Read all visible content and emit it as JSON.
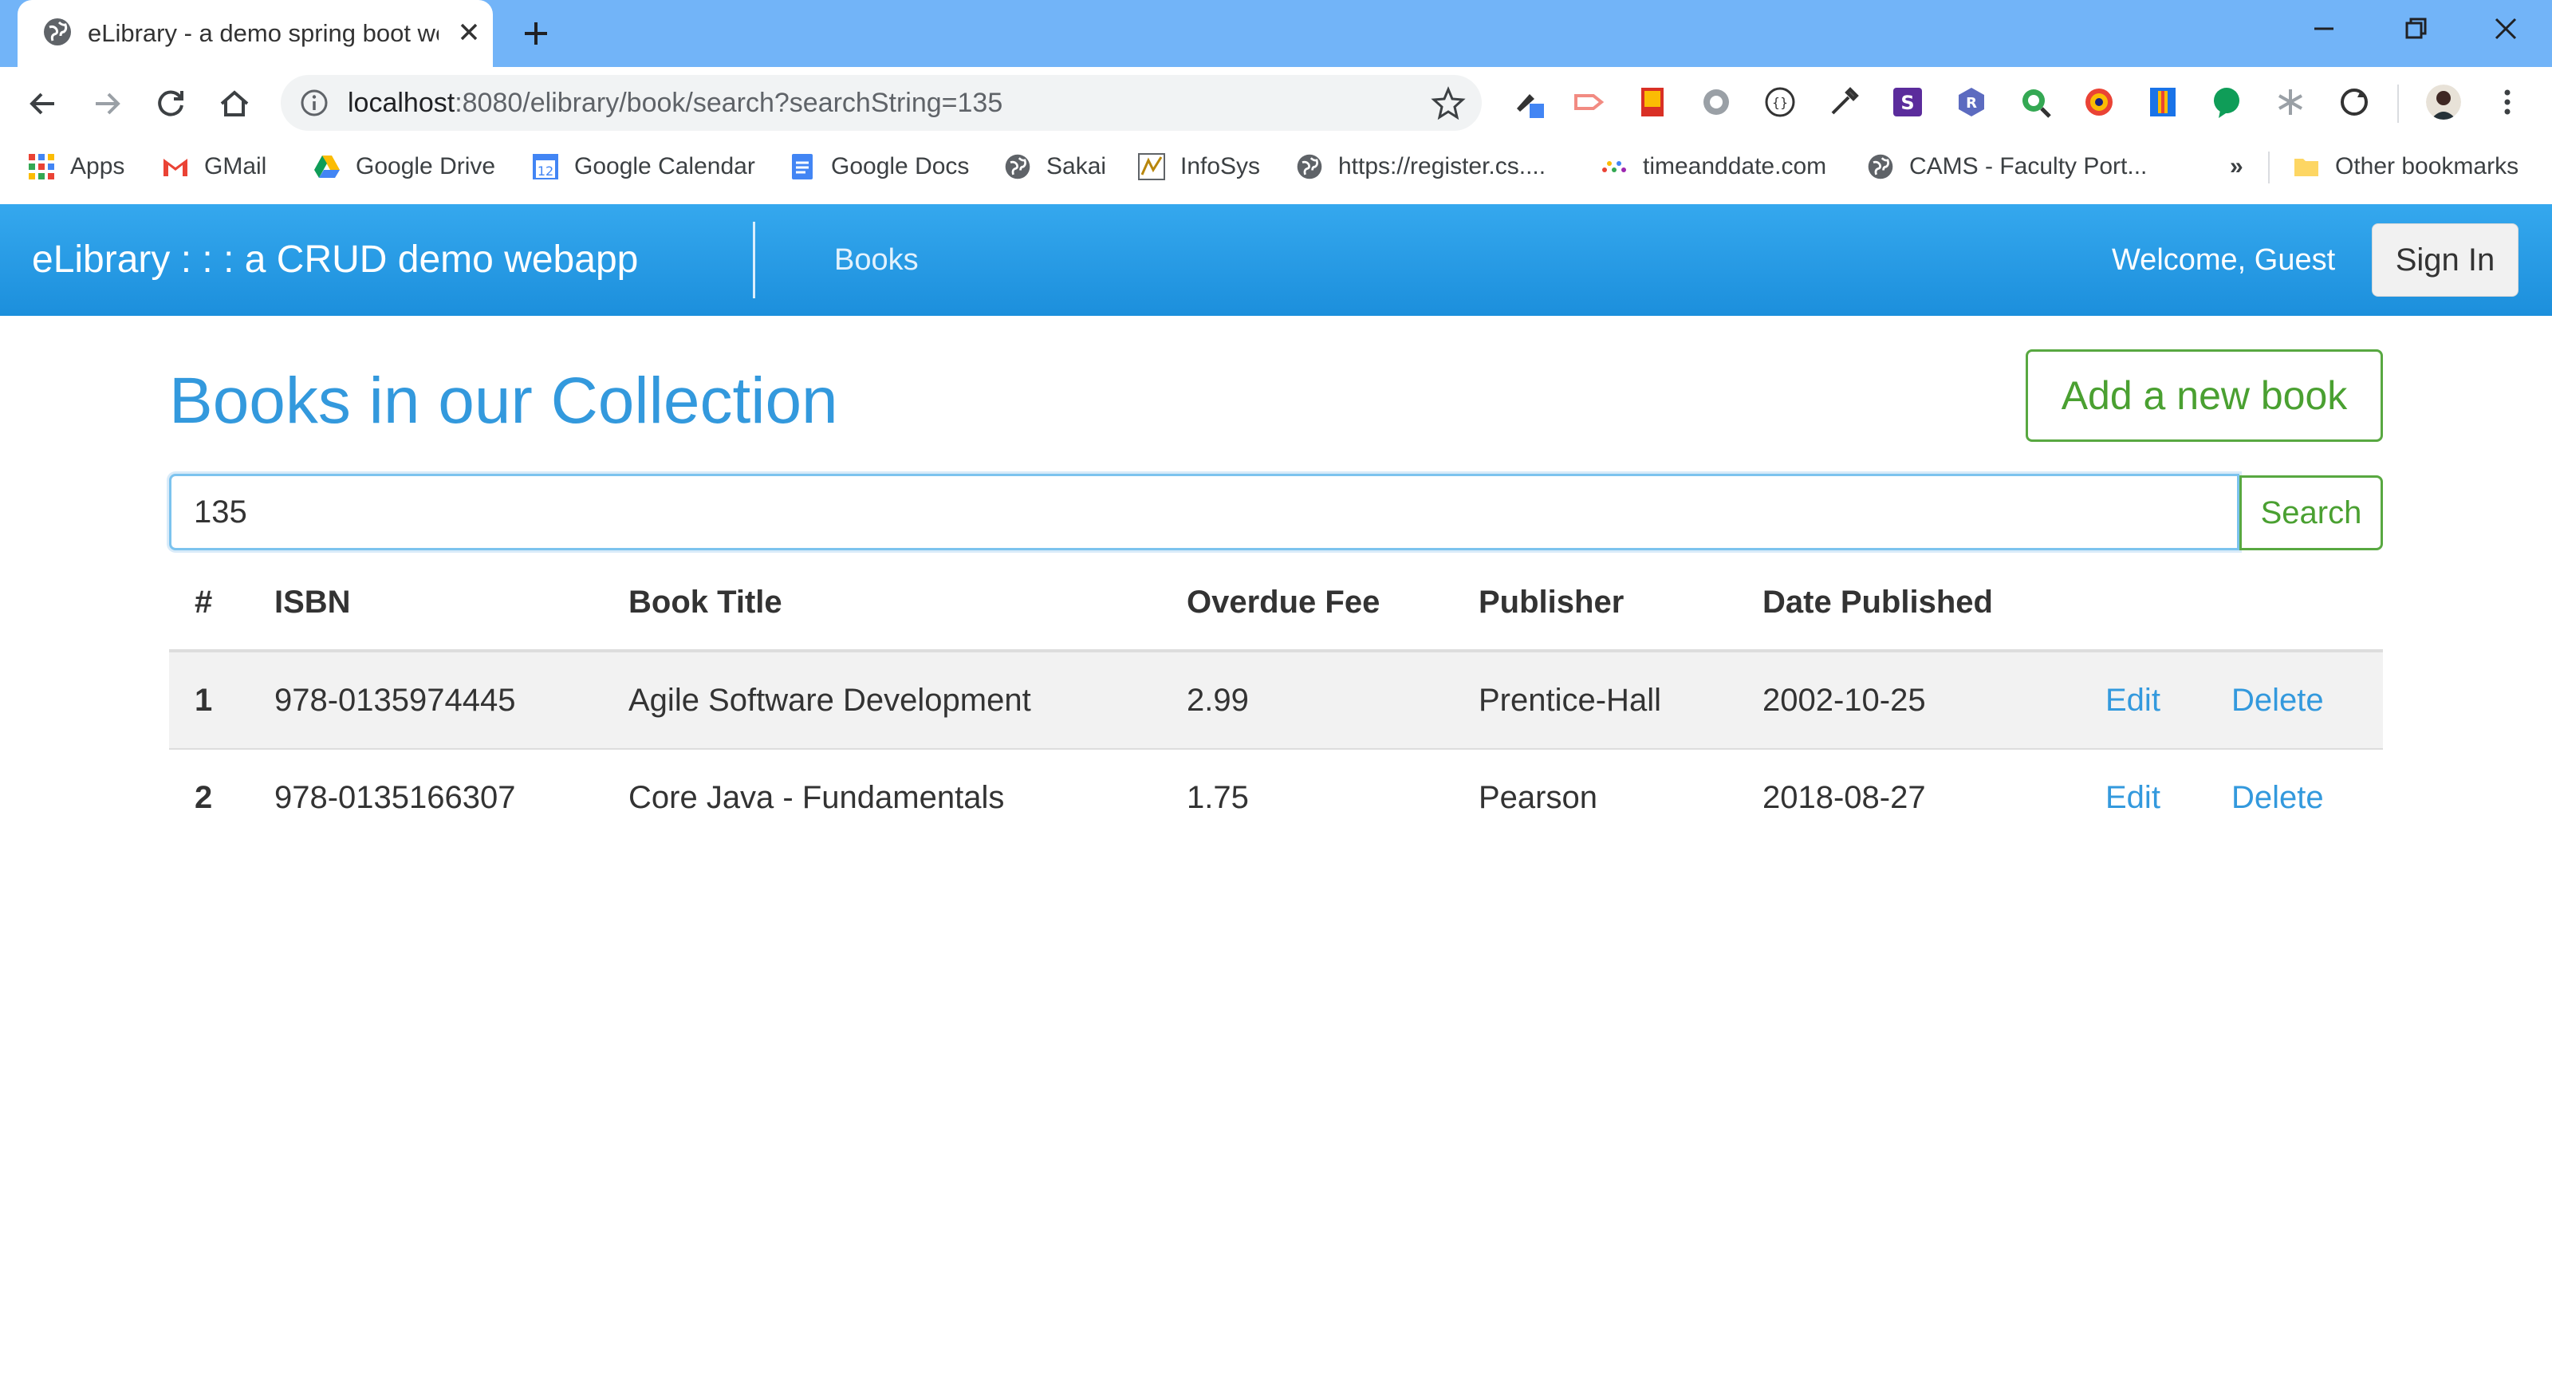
{
  "browser": {
    "tab": {
      "title": "eLibrary - a demo spring boot we"
    },
    "url": {
      "host": "localhost",
      "path": ":8080/elibrary/book/search?searchString=135"
    },
    "bookmarks": [
      {
        "label": "Apps",
        "icon": "apps-grid-icon"
      },
      {
        "label": "GMail",
        "icon": "gmail-icon"
      },
      {
        "label": "Google Drive",
        "icon": "google-drive-icon"
      },
      {
        "label": "Google Calendar",
        "icon": "google-calendar-icon"
      },
      {
        "label": "Google Docs",
        "icon": "google-docs-icon"
      },
      {
        "label": "Sakai",
        "icon": "globe-icon"
      },
      {
        "label": "InfoSys",
        "icon": "infosys-icon"
      },
      {
        "label": "https://register.cs....",
        "icon": "globe-icon"
      },
      {
        "label": "timeanddate.com",
        "icon": "timeanddate-icon"
      },
      {
        "label": "CAMS - Faculty Port...",
        "icon": "globe-icon"
      }
    ],
    "bookmarks_overflow": "»",
    "other_bookmarks": "Other bookmarks",
    "calendar_day": "12"
  },
  "app": {
    "brand": "eLibrary : : : a CRUD demo webapp",
    "nav_books": "Books",
    "welcome": "Welcome, Guest",
    "sign_in": "Sign In"
  },
  "main": {
    "title": "Books in our Collection",
    "add_button": "Add a new book",
    "search_value": "135",
    "search_button": "Search",
    "columns": [
      "#",
      "ISBN",
      "Book Title",
      "Overdue Fee",
      "Publisher",
      "Date Published"
    ],
    "edit_label": "Edit",
    "delete_label": "Delete",
    "rows": [
      {
        "num": "1",
        "isbn": "978-0135974445",
        "title": "Agile Software Development",
        "fee": "2.99",
        "publisher": "Prentice-Hall",
        "date": "2002-10-25"
      },
      {
        "num": "2",
        "isbn": "978-0135166307",
        "title": "Core Java - Fundamentals",
        "fee": "1.75",
        "publisher": "Pearson",
        "date": "2018-08-27"
      }
    ]
  },
  "colors": {
    "accent": "#3399dd",
    "navbar": "#2a9be6",
    "success": "#4aa031"
  }
}
